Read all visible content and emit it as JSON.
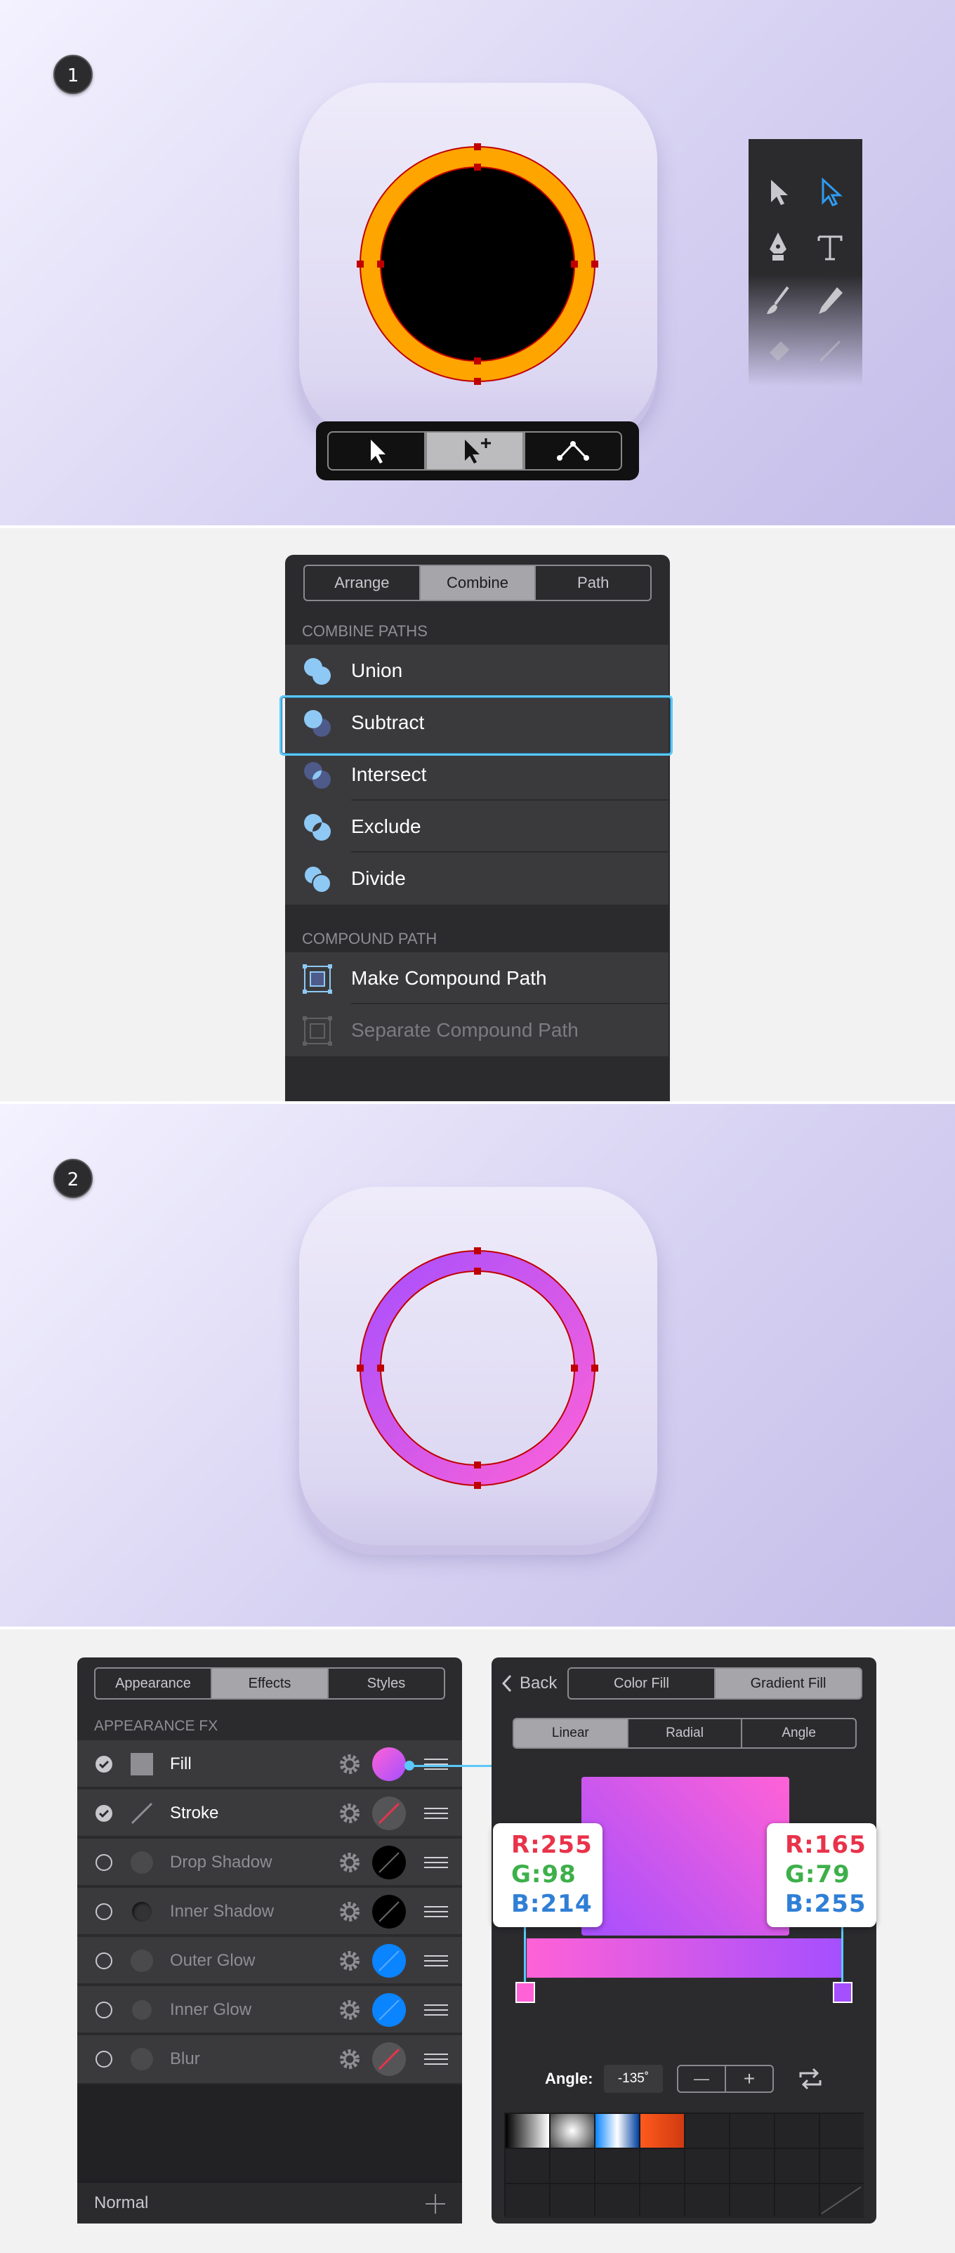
{
  "steps": {
    "first": "1",
    "second": "2"
  },
  "combine_panel": {
    "tabs": [
      {
        "label": "Arrange"
      },
      {
        "label": "Combine"
      },
      {
        "label": "Path"
      }
    ],
    "combine_paths_header": "COMBINE PATHS",
    "combine_items": [
      {
        "label": "Union"
      },
      {
        "label": "Subtract"
      },
      {
        "label": "Intersect"
      },
      {
        "label": "Exclude"
      },
      {
        "label": "Divide"
      }
    ],
    "compound_header": "COMPOUND PATH",
    "compound_items": [
      {
        "label": "Make Compound Path"
      },
      {
        "label": "Separate Compound Path"
      }
    ],
    "selected_item": "Subtract"
  },
  "toolbox_icons": [
    "move-tool-icon",
    "node-tool-icon",
    "pen-tool-icon",
    "text-tool-icon",
    "brush-tool-icon",
    "pencil-tool-icon",
    "eraser-tool-icon",
    "line-tool-icon"
  ],
  "selection_toolbar": [
    "move-icon",
    "node-add-icon",
    "path-node-icon"
  ],
  "appearance_panel": {
    "tabs": [
      {
        "label": "Appearance"
      },
      {
        "label": "Effects"
      },
      {
        "label": "Styles"
      }
    ],
    "header": "APPEARANCE FX",
    "rows": [
      {
        "label": "Fill",
        "enabled": true,
        "swatch": "gradient-purple"
      },
      {
        "label": "Stroke",
        "enabled": true,
        "swatch": "none"
      },
      {
        "label": "Drop Shadow",
        "enabled": false,
        "swatch": "black"
      },
      {
        "label": "Inner Shadow",
        "enabled": false,
        "swatch": "black"
      },
      {
        "label": "Outer Glow",
        "enabled": false,
        "swatch": "#0a84ff"
      },
      {
        "label": "Inner Glow",
        "enabled": false,
        "swatch": "#0a84ff"
      },
      {
        "label": "Blur",
        "enabled": false,
        "swatch": "none"
      }
    ],
    "blend_mode": "Normal"
  },
  "gradient_panel": {
    "back_label": "Back",
    "tabs": [
      {
        "label": "Color Fill"
      },
      {
        "label": "Gradient Fill"
      }
    ],
    "gradient_types": [
      {
        "label": "Linear"
      },
      {
        "label": "Radial"
      },
      {
        "label": "Angle"
      }
    ],
    "left_stop": {
      "r": "R:255",
      "g": "G:98",
      "b": "B:214",
      "hex": "#ff62d6"
    },
    "right_stop": {
      "r": "R:165",
      "g": "G:79",
      "b": "B:255",
      "hex": "#a54fff"
    },
    "angle_label": "Angle:",
    "angle_value": "-135˚",
    "minus_label": "—",
    "plus_label": "+"
  },
  "colors": {
    "ring_orange": "#ffa500",
    "node_red": "#c00000",
    "selection_blue": "#5ac8fa",
    "panel_dark": "#2b2b2e"
  }
}
